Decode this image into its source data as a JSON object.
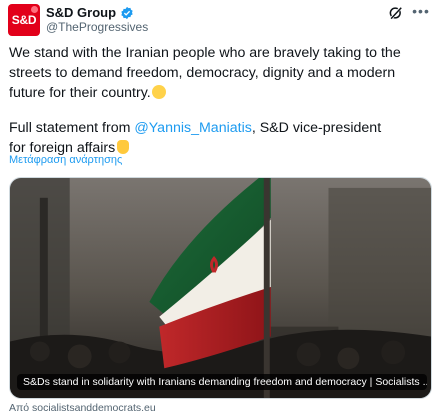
{
  "account": {
    "display_name": "S&D Group",
    "handle": "@TheProgressives",
    "avatar_text": "S&D"
  },
  "tweet": {
    "text": "We stand with the Iranian people who are bravely taking to the streets to demand freedom, democracy, dignity and a modern future for their country.",
    "statement_prefix": "Full statement from ",
    "mention": "@Yannis_Maniatis",
    "statement_suffix": ", S&D vice-president",
    "statement_line2": "for foreign affairs",
    "translate_label": "Μετάφραση ανάρτησης"
  },
  "card": {
    "caption": "S&Ds stand in solidarity with Iranians demanding freedom and democracy | Socialists ...",
    "source": "Από socialistsanddemocrats.eu"
  },
  "icons": {
    "verified": "verified-badge-icon",
    "grok": "grok-icon",
    "more": "more-options-icon"
  },
  "colors": {
    "brand": "#e2001a",
    "link": "#1d9bf0",
    "verified": "#1d9bf0",
    "secondary_text": "#536471"
  }
}
